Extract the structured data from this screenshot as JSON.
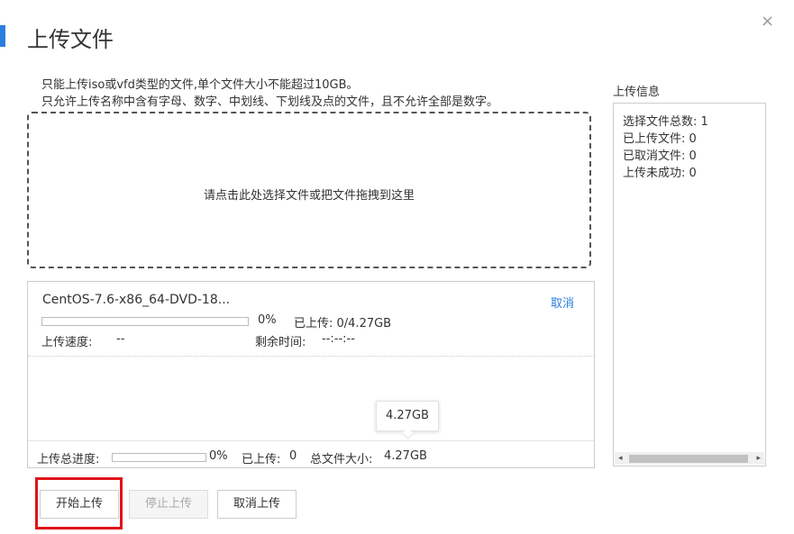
{
  "dialog": {
    "title": "上传文件",
    "close_icon": "×"
  },
  "hints": {
    "line1": "只能上传iso或vfd类型的文件,单个文件大小不能超过10GB。",
    "line2": "只允许上传名称中含有字母、数字、中划线、下划线及点的文件，且不允许全部是数字。"
  },
  "dropzone": {
    "text": "请点击此处选择文件或把文件拖拽到这里"
  },
  "file": {
    "name": "CentOS-7.6-x86_64-DVD-18...",
    "cancel_label": "取消",
    "progress": 0,
    "progress_text": "0%",
    "uploaded_text": "已上传: 0/4.27GB",
    "speed_label": "上传速度:",
    "speed_value": "--",
    "remaining_label": "剩余时间:",
    "remaining_value": "--:--:--"
  },
  "tooltip": {
    "text": "4.27GB"
  },
  "total": {
    "label": "上传总进度:",
    "progress": 0,
    "pct_text": "0%",
    "uploaded_label": "已上传:",
    "uploaded_value": "0",
    "size_label": "总文件大小:",
    "size_value": "4.27GB"
  },
  "info": {
    "title": "上传信息",
    "lines": [
      "选择文件总数: 1",
      "已上传文件: 0",
      "已取消文件: 0",
      "上传未成功: 0"
    ]
  },
  "buttons": {
    "start": "开始上传",
    "stop": "停止上传",
    "cancel": "取消上传"
  },
  "colors": {
    "accent": "#2b7de0",
    "highlight": "#e0121a"
  }
}
